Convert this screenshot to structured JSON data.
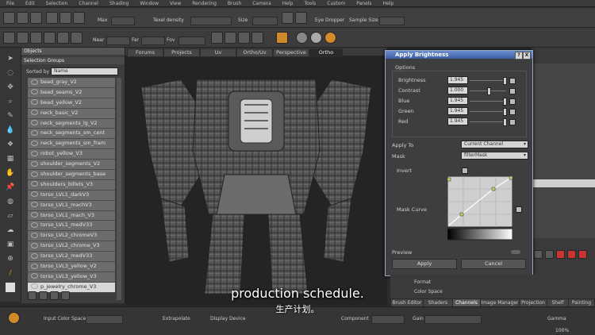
{
  "menu": [
    "File",
    "Edit",
    "Selection",
    "Channel",
    "Shading",
    "Window",
    "View",
    "Rendering",
    "Brush",
    "Camera",
    "Help",
    "Tools",
    "Custom",
    "Panels",
    "Help"
  ],
  "toolbar1": {
    "max_label": "Max",
    "size_label": "Size",
    "pixel_density": "Texel density",
    "size2_label": "Size",
    "eye_dropper": "Eye Dropper",
    "sample_size": "Sample Size"
  },
  "toolbar2": {
    "near": "Near",
    "far": "Far",
    "fov": "Fov"
  },
  "objects_panel": {
    "title": "Objects",
    "selection_groups": "Selection Groups",
    "sorted_by_label": "Sorted by",
    "sorted_by_value": "Name",
    "items": [
      "bead_gray_V2",
      "bead_seams_V2",
      "bead_yellow_V2",
      "neck_basic_V2",
      "neck_segments_lg_V2",
      "neck_segments_sm_cent",
      "neck_segments_sm_fram",
      "robot_yellow_V3",
      "shoulder_segments_V2",
      "shoulder_segments_base",
      "shoulders_billets_V3",
      "torso_LVL1_darkV3",
      "torso_LVL1_machV3",
      "torso_LVL1_mach_V3",
      "torso_LVL1_medV33",
      "torso_LVL2_chromeV3",
      "torso_LVL2_chrome_V3",
      "torso_LVL2_medV33",
      "torso_LVL3_yellow_V2",
      "torso_LVL3_yellow_V3",
      "p_jewelry_chrome_V3"
    ]
  },
  "viewport_tabs": [
    "Forums",
    "Projects",
    "Uv",
    "Ortho/Uv",
    "Perspective",
    "Ortho"
  ],
  "dialog": {
    "title": "Apply Brightness",
    "help_btn": "?",
    "close_btn": "X",
    "options_label": "Options",
    "sliders": [
      {
        "label": "Brightness",
        "value": "1.945",
        "pos": 0.95
      },
      {
        "label": "Contrast",
        "value": "1.000",
        "pos": 0.5
      },
      {
        "label": "Blue",
        "value": "1.945",
        "pos": 0.95
      },
      {
        "label": "Green",
        "value": "1.945",
        "pos": 0.95
      },
      {
        "label": "Red",
        "value": "1.945",
        "pos": 0.95
      }
    ],
    "apply_to_label": "Apply To",
    "apply_to_value": "Current Channel",
    "mask_label": "Mask",
    "mask_value": "filterMask",
    "invert_label": "Invert",
    "mask_curve_label": "Mask Curve",
    "preview_label": "Preview",
    "apply_btn": "Apply",
    "cancel_btn": "Cancel"
  },
  "bottom_panel": {
    "format_label": "Format",
    "color_space": "Color Space",
    "tabs": [
      "Brush Editor",
      "Shaders",
      "Channels",
      "Image Manager",
      "Projection",
      "Shelf",
      "Painting"
    ]
  },
  "statusbar": {
    "input_color_space": "Input Color Space",
    "extrapolate": "Extrapolate",
    "display_device": "Display Device",
    "component": "Component",
    "gain": "Gain",
    "gamma": "Gamma",
    "zoom": "100%"
  },
  "subtitles": {
    "en": "production schedule.",
    "zh": "生产计划。"
  },
  "colors": {
    "accent": "#d08a2a",
    "title_blue": "#4a6eb5"
  }
}
